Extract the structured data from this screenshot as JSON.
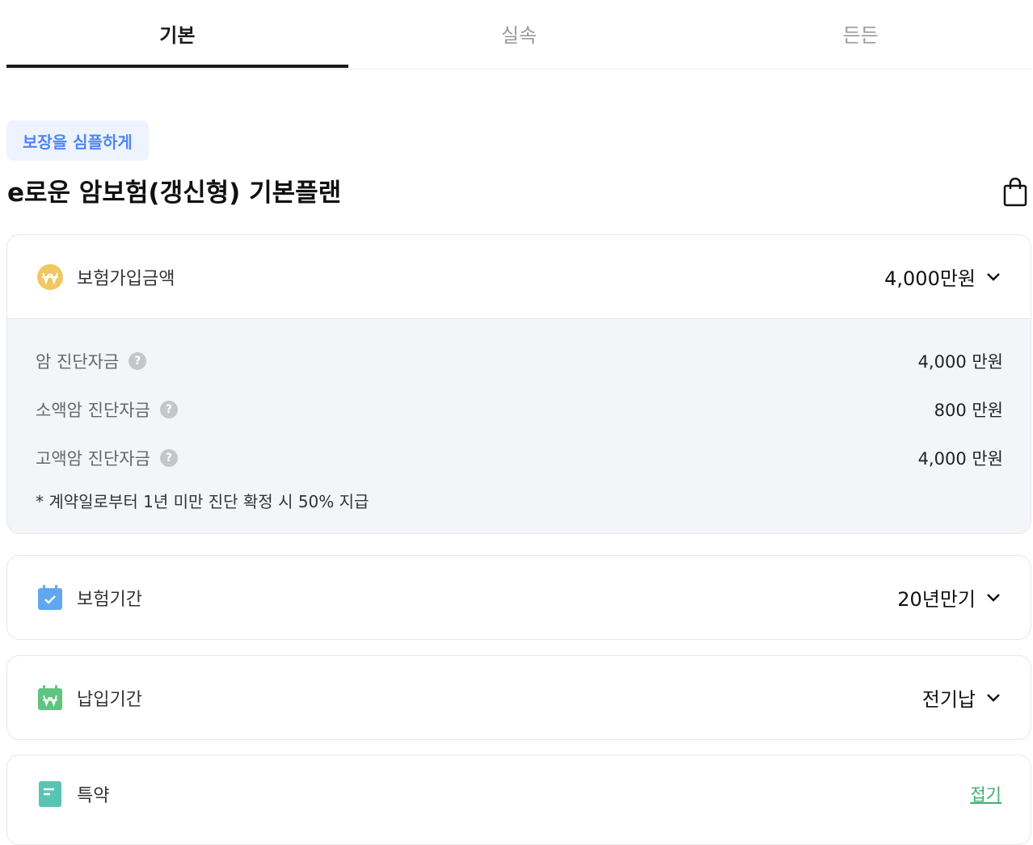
{
  "tabs": [
    {
      "label": "기본",
      "active": true
    },
    {
      "label": "실속",
      "active": false
    },
    {
      "label": "든든",
      "active": false
    }
  ],
  "badge": "보장을 심플하게",
  "plan_title": "e로운 암보험(갱신형) 기본플랜",
  "cart_icon": "shopping-bag-icon",
  "coverage": {
    "label": "보험가입금액",
    "value": "4,000만원",
    "icon": "won-coin-icon",
    "items": [
      {
        "label": "암 진단자금",
        "value": "4,000 만원"
      },
      {
        "label": "소액암 진단자금",
        "value": "800 만원"
      },
      {
        "label": "고액암 진단자금",
        "value": "4,000 만원"
      }
    ],
    "note": "* 계약일로부터 1년 미만 진단 확정 시 50% 지급"
  },
  "insurance_period": {
    "label": "보험기간",
    "value": "20년만기",
    "icon": "calendar-check-icon"
  },
  "payment_period": {
    "label": "납입기간",
    "value": "전기납",
    "icon": "calendar-won-icon"
  },
  "rider": {
    "label": "특약",
    "action": "접기",
    "icon": "document-icon"
  },
  "colors": {
    "accent_blue": "#4f86f0",
    "badge_bg": "#eef3fd",
    "coin": "#f0c860",
    "calendar_blue": "#5fa8f0",
    "calendar_green": "#5fc47f",
    "doc_teal": "#58c4b4",
    "fold_green": "#3bb06c"
  }
}
